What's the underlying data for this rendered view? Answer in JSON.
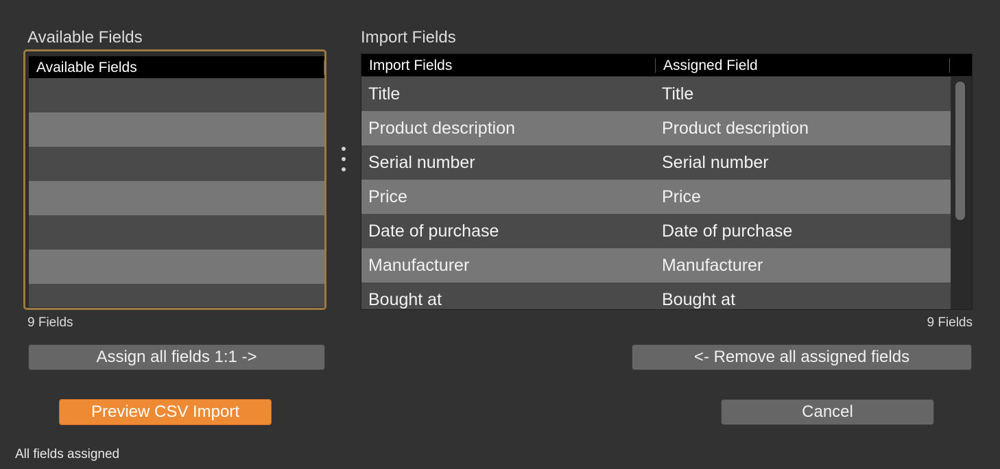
{
  "available_panel": {
    "title": "Available Fields",
    "column_header": "Available Fields",
    "rows": [
      "",
      "",
      "",
      "",
      "",
      "",
      ""
    ],
    "count_label": "9 Fields"
  },
  "import_panel": {
    "title": "Import Fields",
    "columns": [
      "Import Fields",
      "Assigned Field"
    ],
    "rows": [
      {
        "import": "Title",
        "assigned": "Title"
      },
      {
        "import": "Product description",
        "assigned": "Product description"
      },
      {
        "import": "Serial number",
        "assigned": "Serial number"
      },
      {
        "import": "Price",
        "assigned": "Price"
      },
      {
        "import": "Date of purchase",
        "assigned": "Date of purchase"
      },
      {
        "import": "Manufacturer",
        "assigned": "Manufacturer"
      },
      {
        "import": "Bought at",
        "assigned": "Bought at"
      }
    ],
    "count_label": "9 Fields"
  },
  "buttons": {
    "assign_all": "Assign all fields 1:1 ->",
    "remove_all": "<- Remove all assigned fields",
    "preview": "Preview CSV Import",
    "cancel": "Cancel"
  },
  "status": "All fields assigned",
  "colors": {
    "background": "#323232",
    "accent_orange": "#ef8a34",
    "focus_border": "#9a7a45",
    "row_dark": "#4a4a4a",
    "row_light": "#777777"
  }
}
